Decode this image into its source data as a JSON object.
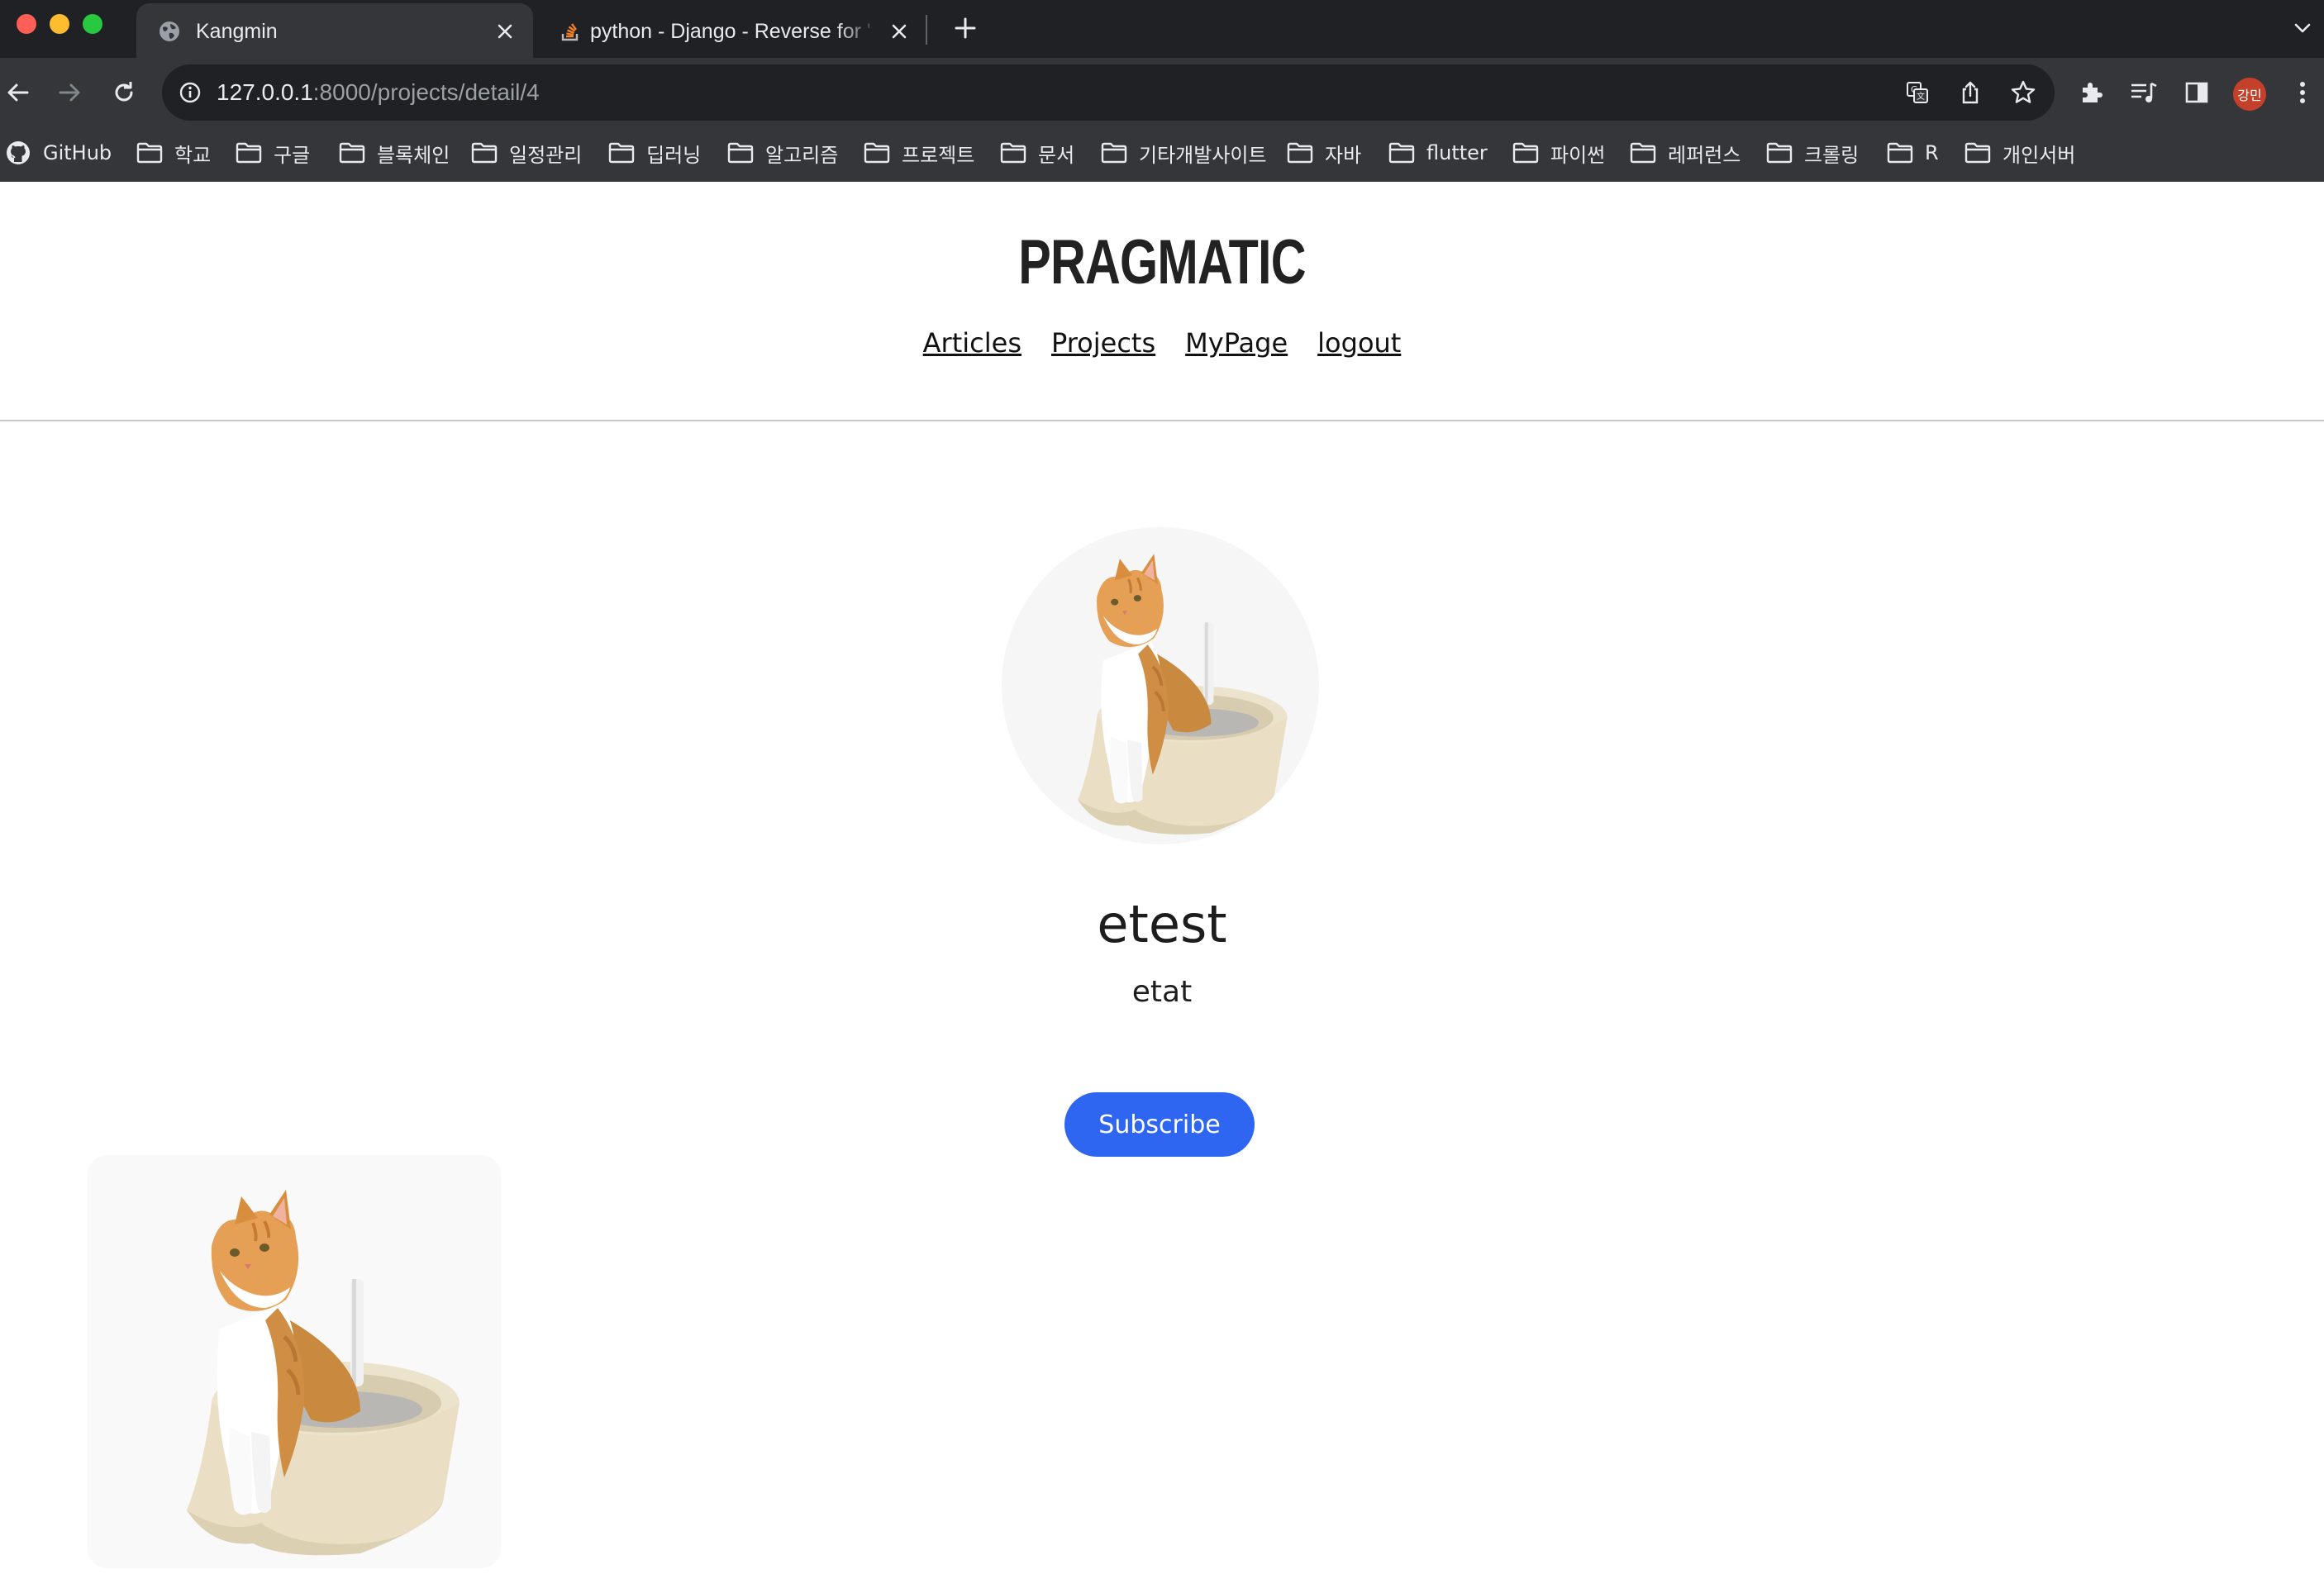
{
  "browser": {
    "tabs": [
      {
        "title": "Kangmin",
        "icon": "globe-icon",
        "active": true
      },
      {
        "title": "python - Django - Reverse for '",
        "icon": "stackoverflow-icon",
        "active": false
      }
    ],
    "url": {
      "host": "127.0.0.1",
      "rest": ":8000/projects/detail/4"
    },
    "profile_initials": "강민",
    "bookmarks": [
      {
        "label": "GitHub",
        "icon": "github-icon"
      },
      {
        "label": "학교",
        "icon": "folder-icon"
      },
      {
        "label": "구글",
        "icon": "folder-icon"
      },
      {
        "label": "블록체인",
        "icon": "folder-icon"
      },
      {
        "label": "일정관리",
        "icon": "folder-icon"
      },
      {
        "label": "딥러닝",
        "icon": "folder-icon"
      },
      {
        "label": "알고리즘",
        "icon": "folder-icon"
      },
      {
        "label": "프로젝트",
        "icon": "folder-icon"
      },
      {
        "label": "문서",
        "icon": "folder-icon"
      },
      {
        "label": "기타개발사이트",
        "icon": "folder-icon"
      },
      {
        "label": "자바",
        "icon": "folder-icon"
      },
      {
        "label": "flutter",
        "icon": "folder-icon"
      },
      {
        "label": "파이썬",
        "icon": "folder-icon"
      },
      {
        "label": "레퍼런스",
        "icon": "folder-icon"
      },
      {
        "label": "크롤링",
        "icon": "folder-icon"
      },
      {
        "label": "R",
        "icon": "folder-icon"
      },
      {
        "label": "개인서버",
        "icon": "folder-icon"
      }
    ]
  },
  "site": {
    "logo": "PRAGMATIC",
    "nav": [
      "Articles",
      "Projects",
      "MyPage",
      "logout"
    ]
  },
  "project": {
    "title": "etest",
    "description": "etat",
    "subscribe_label": "Subscribe",
    "image": "cat-in-litter-box-image"
  },
  "colors": {
    "accent": "#2f66f1",
    "chrome_dark": "#202124",
    "chrome_toolbar": "#35363a"
  }
}
